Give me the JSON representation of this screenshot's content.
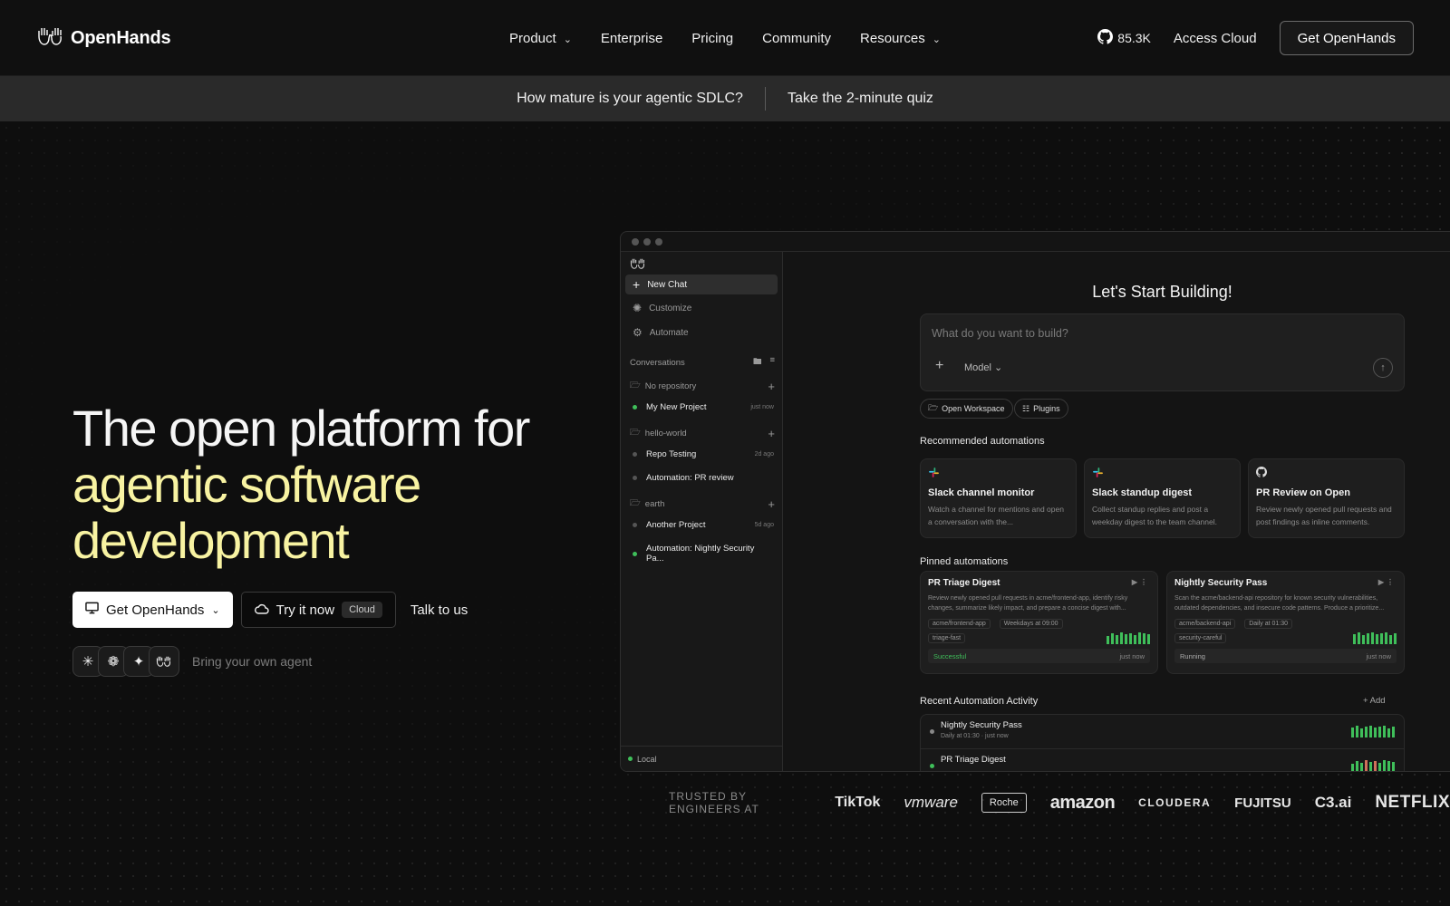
{
  "nav": {
    "brand": "OpenHands",
    "links": [
      {
        "label": "Product",
        "has_menu": true
      },
      {
        "label": "Enterprise",
        "has_menu": false
      },
      {
        "label": "Pricing",
        "has_menu": false
      },
      {
        "label": "Community",
        "has_menu": false
      },
      {
        "label": "Resources",
        "has_menu": true
      }
    ],
    "github_stars": "85.3K",
    "access_cloud": "Access Cloud",
    "cta": "Get OpenHands"
  },
  "banner": {
    "question": "How mature is your agentic SDLC?",
    "cta": "Take the 2-minute quiz"
  },
  "hero": {
    "title_line1": "The open platform for",
    "title_highlight": "agentic software development",
    "btn_get": "Get OpenHands",
    "btn_try": "Try it now",
    "btn_try_badge": "Cloud",
    "btn_talk": "Talk to us",
    "byo": "Bring your own agent",
    "agent_icons": [
      "claude-icon",
      "openai-icon",
      "gemini-icon",
      "openhands-icon"
    ]
  },
  "app": {
    "sidebar": {
      "new_chat": "New Chat",
      "customize": "Customize",
      "automate": "Automate",
      "conversations": "Conversations",
      "folders": [
        {
          "name": "No repository",
          "convs": [
            {
              "title": "My New Project",
              "time": "just now",
              "active": true
            }
          ]
        },
        {
          "name": "hello-world",
          "convs": [
            {
              "title": "Repo Testing",
              "time": "2d ago",
              "active": false
            },
            {
              "title": "Automation: PR review",
              "time": "",
              "active": false
            }
          ]
        },
        {
          "name": "earth",
          "convs": [
            {
              "title": "Another Project",
              "time": "5d ago",
              "active": false
            },
            {
              "title": "Automation: Nightly Security Pa...",
              "time": "",
              "active": true
            }
          ]
        }
      ],
      "footer": "Local"
    },
    "main": {
      "heading": "Let's Start Building!",
      "prompt_placeholder": "What do you want to build?",
      "model_label": "Model",
      "chip_workspace": "Open Workspace",
      "chip_plugins": "Plugins",
      "recommended_title": "Recommended automations",
      "recommended": [
        {
          "icon": "slack-icon",
          "title": "Slack channel monitor",
          "desc": "Watch a channel for mentions and open a conversation with the..."
        },
        {
          "icon": "slack-icon",
          "title": "Slack standup digest",
          "desc": "Collect standup replies and post a weekday digest to the team channel."
        },
        {
          "icon": "github-icon",
          "title": "PR Review on Open",
          "desc": "Review newly opened pull requests and post findings as inline comments."
        }
      ],
      "pinned_title": "Pinned automations",
      "pinned": [
        {
          "title": "PR Triage Digest",
          "desc": "Review newly opened pull requests in acme/frontend-app, identify risky changes, summarize likely impact, and prepare a concise digest with...",
          "repo": "acme/frontend-app",
          "schedule": "Weekdays at 09:00",
          "tag": "triage-fast",
          "status": "Successful",
          "time": "just now"
        },
        {
          "title": "Nightly Security Pass",
          "desc": "Scan the acme/backend-api repository for known security vulnerabilities, outdated dependencies, and insecure code patterns. Produce a prioritize...",
          "repo": "acme/backend-api",
          "schedule": "Daily at 01:30",
          "tag": "security-careful",
          "status": "Running",
          "time": "just now"
        }
      ],
      "recent_title": "Recent Automation Activity",
      "recent_add": "Add",
      "recent": [
        {
          "title": "Nightly Security Pass",
          "sub": "Daily at 01:30 · just now"
        },
        {
          "title": "PR Triage Digest",
          "sub": ""
        }
      ]
    }
  },
  "trusted": {
    "label": "TRUSTED BY ENGINEERS AT",
    "brands": [
      "TikTok",
      "vmware",
      "Roche",
      "amazon",
      "CLOUDERA",
      "FUJITSU",
      "C3.ai",
      "NETFLIX"
    ]
  },
  "colors": {
    "accent_yellow": "#f8f3a2",
    "success_green": "#3fbf5a",
    "background": "#0e0e0e"
  }
}
